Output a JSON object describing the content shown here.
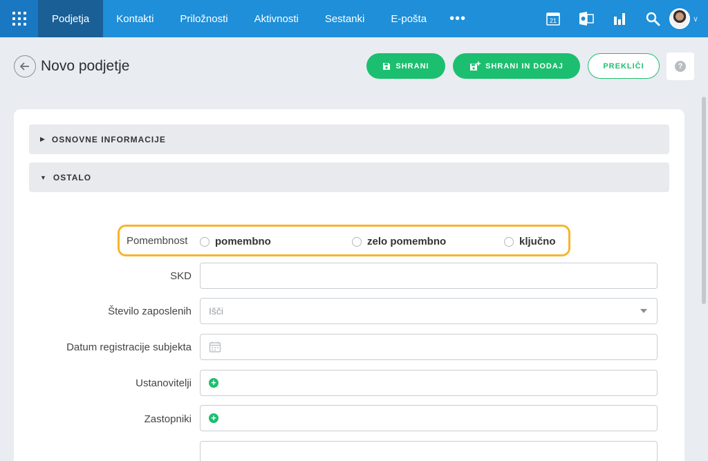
{
  "topnav": {
    "items": [
      {
        "label": "Podjetja",
        "active": true
      },
      {
        "label": "Kontakti"
      },
      {
        "label": "Priložnosti"
      },
      {
        "label": "Aktivnosti"
      },
      {
        "label": "Sestanki"
      },
      {
        "label": "E-pošta"
      }
    ],
    "more": "•••",
    "calendar_day": "21",
    "icons": [
      "apps-grid-icon",
      "calendar-icon",
      "outlook-icon",
      "chart-icon",
      "search-icon",
      "avatar"
    ]
  },
  "header": {
    "title": "Novo podjetje",
    "save_label": "SHRANI",
    "save_add_label": "SHRANI IN DODAJ",
    "cancel_label": "PREKLIČI",
    "help": "?"
  },
  "sections": [
    {
      "label": "OSNOVNE INFORMACIJE",
      "expanded": false
    },
    {
      "label": "OSTALO",
      "expanded": true
    }
  ],
  "form": {
    "importance": {
      "label": "Pomembnost",
      "options": [
        "pomembno",
        "zelo pomembno",
        "ključno"
      ]
    },
    "skd": {
      "label": "SKD",
      "value": ""
    },
    "employees": {
      "label": "Število zaposlenih",
      "placeholder": "Išči"
    },
    "reg_date": {
      "label": "Datum registracije subjekta",
      "value": ""
    },
    "founders": {
      "label": "Ustanovitelji"
    },
    "representatives": {
      "label": "Zastopniki"
    }
  },
  "colors": {
    "nav": "#1e8fd8",
    "nav_active": "#1b5f97",
    "accent": "#1cbf6f",
    "highlight": "#f6b42c"
  }
}
